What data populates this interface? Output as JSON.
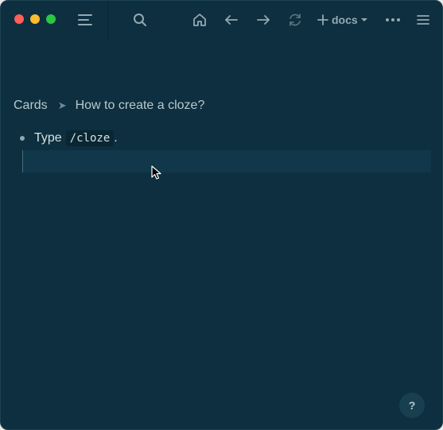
{
  "toolbar": {
    "icons": [
      "sidebar-toggle-icon",
      "search-icon",
      "home-icon",
      "arrow-left-icon",
      "arrow-right-icon",
      "sync-icon",
      "plus-icon",
      "more-icon",
      "menu-icon"
    ],
    "docs_label": "docs"
  },
  "breadcrumb": {
    "parent": "Cards",
    "current": "How to create a cloze?"
  },
  "block": {
    "text_before": "Type",
    "code": "/cloze",
    "text_after": "."
  },
  "help": {
    "label": "?"
  },
  "colors": {
    "background": "#0d2f3f",
    "editor_line": "#10374a",
    "text": "#d6e1e4",
    "icon": "#93a9b2"
  }
}
